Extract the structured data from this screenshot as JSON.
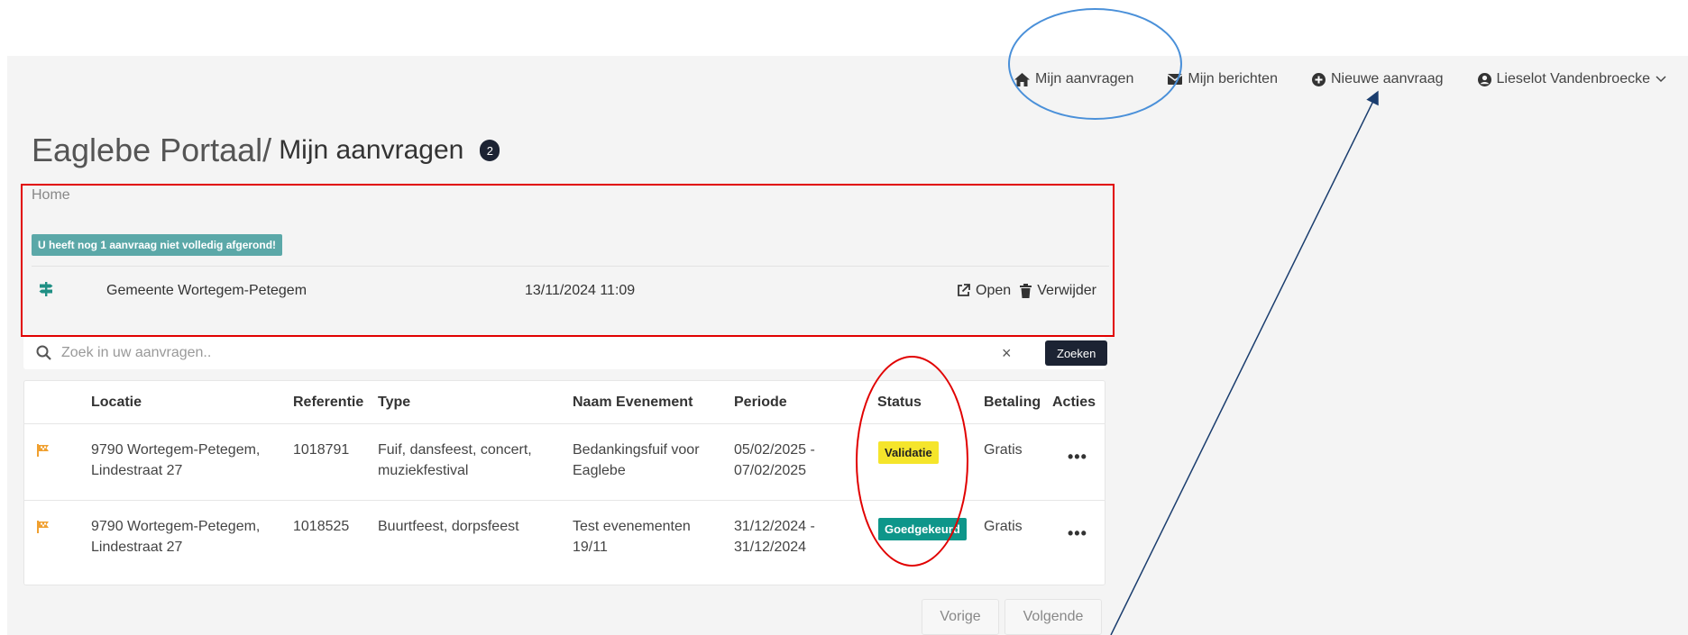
{
  "nav": {
    "my_requests": "Mijn aanvragen",
    "my_messages": "Mijn berichten",
    "new_request": "Nieuwe aanvraag",
    "user_name": "Lieselot Vandenbroecke"
  },
  "header": {
    "portal": "Eaglebe Portaal/",
    "page": "Mijn aanvragen",
    "count": "2"
  },
  "breadcrumb": "Home",
  "draft": {
    "warning": "U heeft nog 1 aanvraag niet volledig afgerond!",
    "name": "Gemeente Wortegem-Petegem",
    "date": "13/11/2024 11:09",
    "open_label": "Open",
    "delete_label": "Verwijder"
  },
  "search": {
    "placeholder": "Zoek in uw aanvragen..",
    "clear": "×",
    "button": "Zoeken"
  },
  "table": {
    "headers": [
      "Locatie",
      "Referentie",
      "Type",
      "Naam Evenement",
      "Periode",
      "Status",
      "Betaling",
      "Acties"
    ],
    "rows": [
      {
        "location_1": "9790 Wortegem-Petegem,",
        "location_2": "Lindestraat 27",
        "reference": "1018791",
        "type_1": "Fuif, dansfeest, concert,",
        "type_2": "muziekfestival",
        "event_1": "Bedankingsfuif voor",
        "event_2": "Eaglebe",
        "period_1": "05/02/2025 -",
        "period_2": "07/02/2025",
        "status": "Validatie",
        "payment": "Gratis",
        "actions": "•••"
      },
      {
        "location_1": "9790 Wortegem-Petegem,",
        "location_2": "Lindestraat 27",
        "reference": "1018525",
        "type_1": "Buurtfeest, dorpsfeest",
        "type_2": "",
        "event_1": "Test evenementen",
        "event_2": "19/11",
        "period_1": "31/12/2024 -",
        "period_2": "31/12/2024",
        "status": "Goedgekeurd",
        "payment": "Gratis",
        "actions": "•••"
      }
    ]
  },
  "pagination": {
    "previous": "Vorige",
    "next": "Volgende"
  },
  "colors": {
    "dark": "#1c2333",
    "warning_badge": "#5ba8a8",
    "status_validatie": "#f5e52b",
    "status_goedgekeurd": "#0e968a",
    "flag": "#f0a030",
    "annotation_red": "#e10000",
    "annotation_blue": "#4a90d9",
    "annotation_arrow": "#1a3d6e"
  },
  "icons": {
    "nav_my_requests": "home-icon",
    "nav_messages": "envelope-icon",
    "nav_new": "plus-circle-icon",
    "nav_user": "user-circle-icon",
    "draft": "signpost-icon",
    "open": "external-link-icon",
    "delete": "trash-icon",
    "search": "search-icon",
    "row_flag": "flag-icon"
  }
}
